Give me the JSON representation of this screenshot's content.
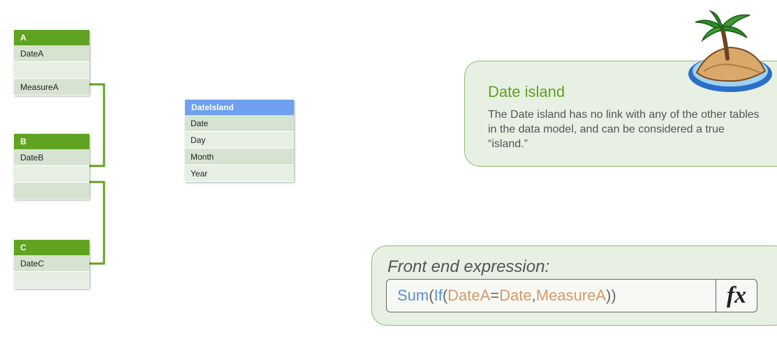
{
  "tables": {
    "a": {
      "header": "A",
      "rows": [
        "DateA",
        "",
        "MeasureA"
      ]
    },
    "b": {
      "header": "B",
      "rows": [
        "DateB",
        "",
        ""
      ]
    },
    "c": {
      "header": "C",
      "rows": [
        "DateC",
        ""
      ]
    },
    "dateisland": {
      "header": "DateIsland",
      "rows": [
        "Date",
        "Day",
        "Month",
        "Year"
      ]
    }
  },
  "callout": {
    "title": "Date island",
    "body": "The Date island has no link with any of the other tables in the data model, and can be considered a true “island.”"
  },
  "expression": {
    "label": "Front end expression:",
    "formula": {
      "fn1": "Sum",
      "p1": "(",
      "fn2": "If",
      "p2": "(",
      "arg1": "DateA",
      "eq": "=",
      "arg2": "Date",
      "comma": ",",
      "arg3": "MeasureA",
      "p3": "))"
    },
    "fx_label": "fx"
  },
  "colors": {
    "table_header": "#5fa320",
    "island_header": "#6f9ff0",
    "link_line": "#5fa320",
    "callout_title": "#5aa41f",
    "function_name": "#5b8fd6",
    "field_name": "#d59a6a"
  },
  "icons": [
    "palm-island-icon",
    "fx-icon"
  ]
}
